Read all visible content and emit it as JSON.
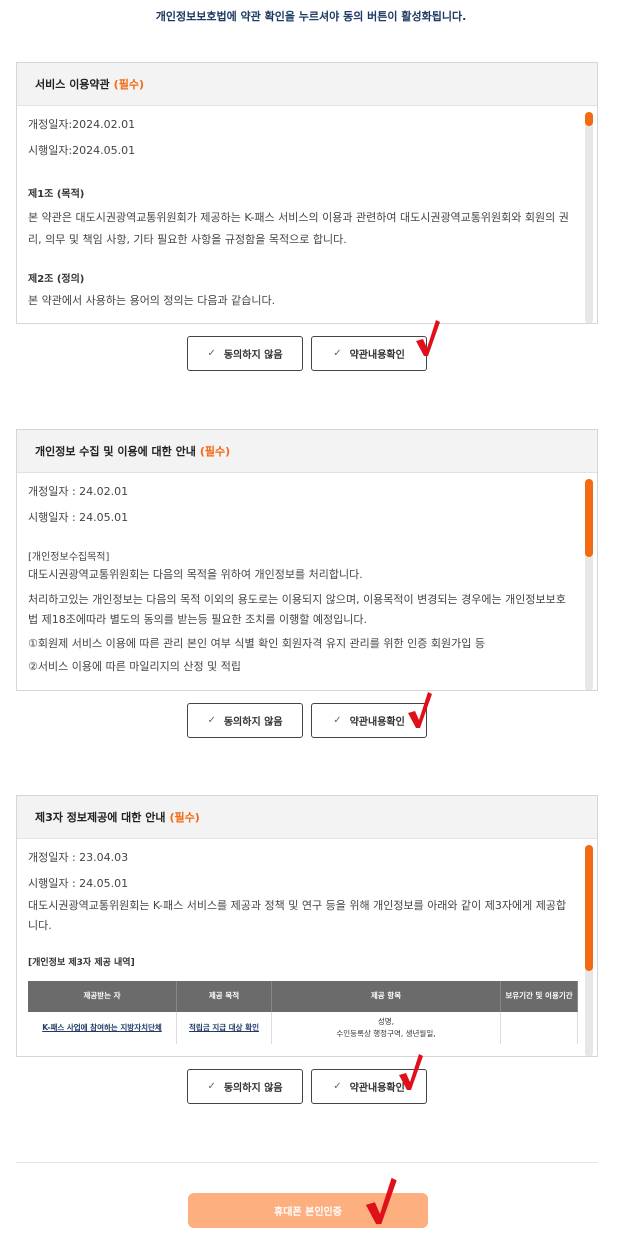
{
  "notice": "개인정보보호법에 약관 확인을 누르셔야 동의 버튼이 활성화됩니다.",
  "panels": [
    {
      "title": "서비스 이용약관",
      "required": "(필수)",
      "lines": [
        "개정일자:2024.02.01",
        "시행일자:2024.05.01",
        "제1조 (목적)",
        "본 약관은 대도시권광역교통위원회가 제공하는 K-패스 서비스의 이용과 관련하여 대도시권광역교통위원회와 회원의 권리, 의무 및 책임 사항, 기타 필요한 사항을 규정함을 목적으로 합니다.",
        "제2조 (정의)",
        "본 약관에서 사용하는 용어의 정의는 다음과 같습니다."
      ],
      "disagree": "동의하지 않음",
      "confirm": "약관내용확인"
    },
    {
      "title": "개인정보 수집 및 이용에 대한 안내",
      "required": "(필수)",
      "lines": [
        "개정일자 : 24.02.01",
        "시행일자 : 24.05.01",
        "[개인정보수집목적]",
        "대도시권광역교통위원회는 다음의 목적을 위하여 개인정보를 처리합니다.",
        "처리하고있는 개인정보는 다음의 목적 이외의 용도로는 이용되지 않으며, 이용목적이 변경되는 경우에는 개인정보보호법 제18조에따라 별도의 동의를 받는등 필요한 조치를 이행할 예정입니다.",
        "①회원제 서비스 이용에 따른 관리 본인 여부 식별 확인 회원자격 유지 관리를 위한 인증 회원가입 등",
        "②서비스 이용에 따른 마일리지의 산정 및 적립"
      ],
      "disagree": "동의하지 않음",
      "confirm": "약관내용확인"
    },
    {
      "title": "제3자 정보제공에 대한 안내",
      "required": "(필수)",
      "lines": [
        "개정일자 : 23.04.03",
        "시행일자 : 24.05.01",
        "대도시권광역교통위원회는 K-패스 서비스를 제공과 정책 및 연구 등을 위해 개인정보를 아래와 같이 제3자에게 제공합니다.",
        "[개인정보 제3자 제공 내역]"
      ],
      "table": {
        "headers": [
          "제공받는 자",
          "제공 목적",
          "제공 항목",
          "보유기간 및 이용기간"
        ],
        "row": [
          "K-패스 사업에 참여하는 지방자치단체",
          "적립금 지급 대상 확인",
          "성명,",
          "수인등록상 행정구역, 생년월일,",
          ""
        ]
      },
      "disagree": "동의하지 않음",
      "confirm": "약관내용확인"
    }
  ],
  "check_icon": "✓",
  "submit_label": "휴대폰 본인인증",
  "colors": {
    "accent": "#f26a12",
    "submit": "#fdaf80",
    "mark": "#e0101a"
  }
}
